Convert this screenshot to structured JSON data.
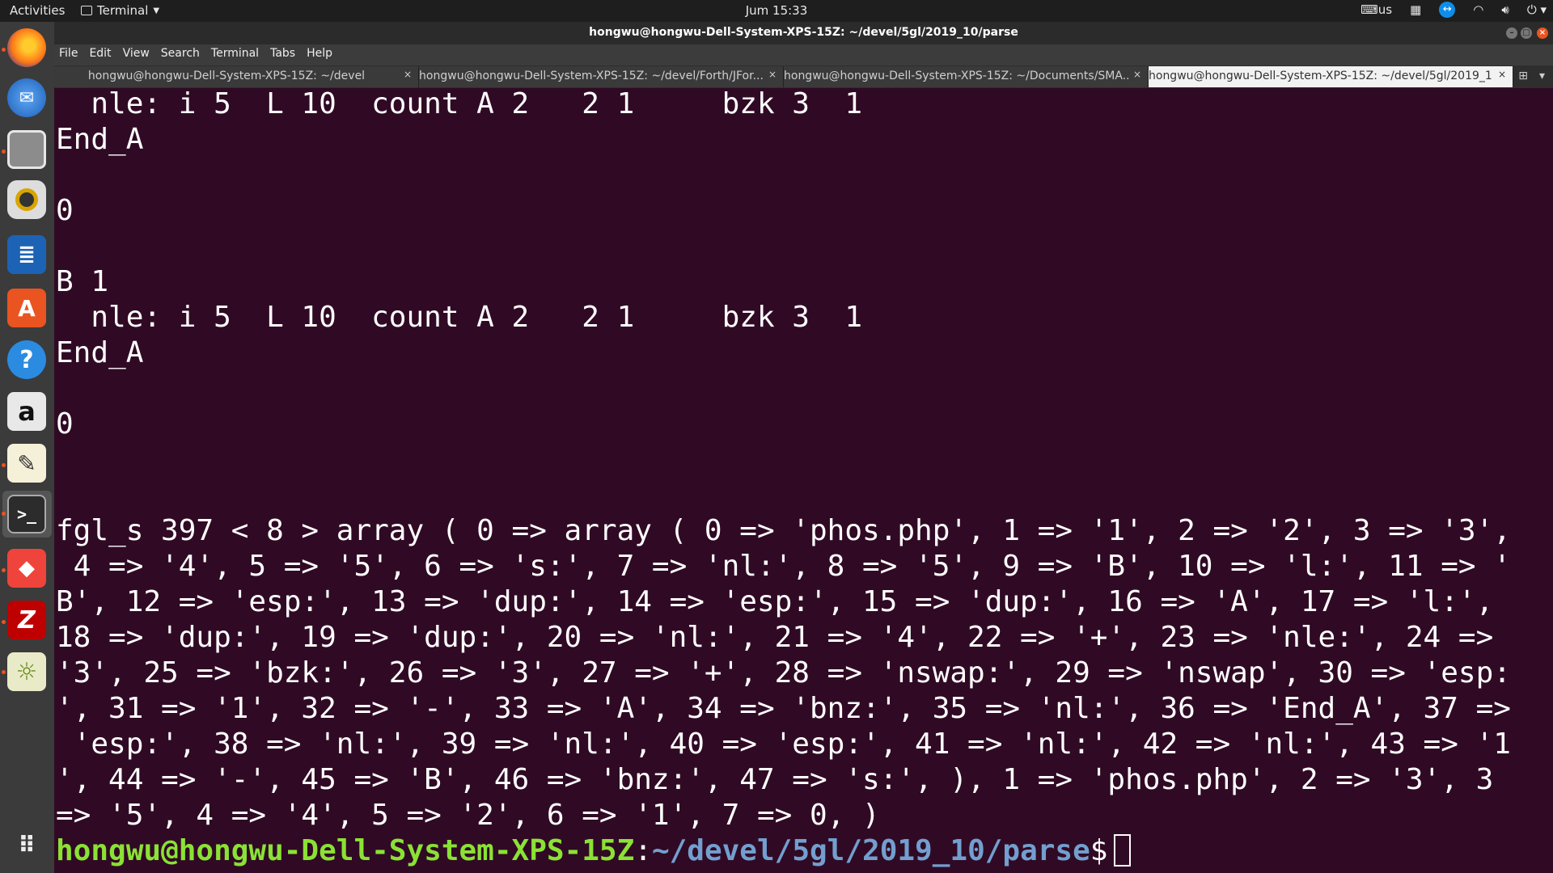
{
  "topbar": {
    "activities": "Activities",
    "app_name": "Terminal",
    "clock": "Jum 15:33",
    "keyboard_layout": "us"
  },
  "window": {
    "title": "hongwu@hongwu-Dell-System-XPS-15Z: ~/devel/5gl/2019_10/parse"
  },
  "menu": [
    "File",
    "Edit",
    "View",
    "Search",
    "Terminal",
    "Tabs",
    "Help"
  ],
  "tabs": [
    {
      "label": "hongwu@hongwu-Dell-System-XPS-15Z: ~/devel"
    },
    {
      "label": "hongwu@hongwu-Dell-System-XPS-15Z: ~/devel/Forth/JFor..."
    },
    {
      "label": "hongwu@hongwu-Dell-System-XPS-15Z: ~/Documents/SMA..."
    },
    {
      "label": "hongwu@hongwu-Dell-System-XPS-15Z: ~/devel/5gl/2019_1..."
    }
  ],
  "dock": [
    "firefox-icon",
    "thunderbird-icon",
    "files-icon",
    "rhythmbox-icon",
    "writer-icon",
    "software-icon",
    "help-icon",
    "amazon-icon",
    "text-editor-icon",
    "terminal-icon",
    "anydesk-icon",
    "filezilla-icon",
    "settings-icon",
    "app-grid-icon"
  ],
  "terminal": {
    "lines": [
      "  nle: i 5  L 10  count A 2   2 1     bzk 3  1",
      "End_A",
      "",
      "0",
      "",
      "B 1",
      "  nle: i 5  L 10  count A 2   2 1     bzk 3  1",
      "End_A",
      "",
      "0",
      "",
      "",
      "fgl_s 397 < 8 > array ( 0 => array ( 0 => 'phos.php', 1 => '1', 2 => '2', 3 => '3',",
      " 4 => '4', 5 => '5', 6 => 's:', 7 => 'nl:', 8 => '5', 9 => 'B', 10 => 'l:', 11 => '",
      "B', 12 => 'esp:', 13 => 'dup:', 14 => 'esp:', 15 => 'dup:', 16 => 'A', 17 => 'l:',",
      "18 => 'dup:', 19 => 'dup:', 20 => 'nl:', 21 => '4', 22 => '+', 23 => 'nle:', 24 =>",
      "'3', 25 => 'bzk:', 26 => '3', 27 => '+', 28 => 'nswap:', 29 => 'nswap', 30 => 'esp:",
      "', 31 => '1', 32 => '-', 33 => 'A', 34 => 'bnz:', 35 => 'nl:', 36 => 'End_A', 37 =>",
      " 'esp:', 38 => 'nl:', 39 => 'nl:', 40 => 'esp:', 41 => 'nl:', 42 => 'nl:', 43 => '1",
      "', 44 => '-', 45 => 'B', 46 => 'bnz:', 47 => 's:', ), 1 => 'phos.php', 2 => '3', 3",
      "=> '5', 4 => '4', 5 => '2', 6 => '1', 7 => 0, )"
    ],
    "prompt_user": "hongwu@hongwu-Dell-System-XPS-15Z",
    "prompt_sep": ":",
    "prompt_path": "~/devel/5gl/2019_10/parse",
    "prompt_symbol": "$"
  }
}
